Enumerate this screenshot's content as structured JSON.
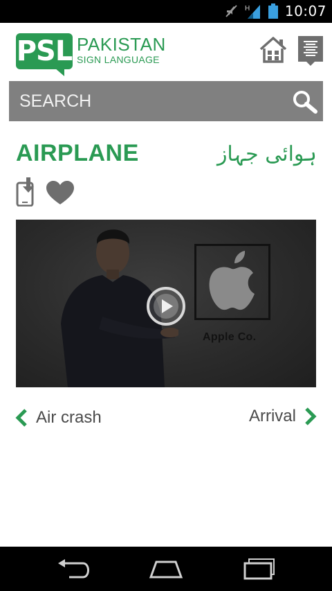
{
  "status_bar": {
    "time": "10:07",
    "network_label": "H",
    "icons": [
      "mute-icon",
      "signal-icon",
      "battery-icon"
    ]
  },
  "header": {
    "logo_mark": "PSL",
    "logo_line1": "PAKISTAN",
    "logo_line2": "SIGN LANGUAGE",
    "icons": [
      "home-icon",
      "menu-icon"
    ]
  },
  "search": {
    "placeholder": "SEARCH"
  },
  "word": {
    "title": "AIRPLANE",
    "urdu": "ہوائی جہاز"
  },
  "video": {
    "caption": "Apple Co."
  },
  "navigation": {
    "prev_label": "Air crash",
    "next_label": "Arrival"
  },
  "colors": {
    "brand_green": "#2a9a53",
    "search_bg": "#808080",
    "text_dark": "#4a4a4a"
  }
}
